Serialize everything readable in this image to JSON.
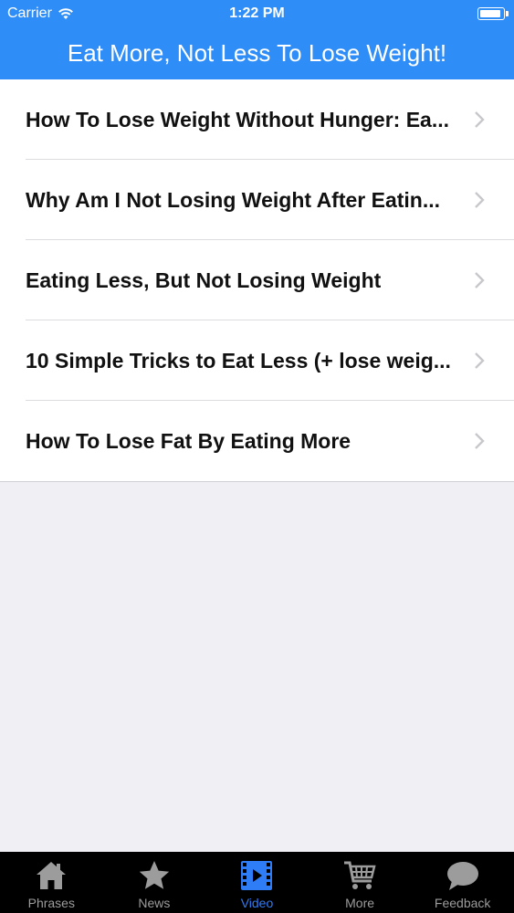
{
  "status_bar": {
    "carrier": "Carrier",
    "time": "1:22 PM",
    "battery_level": 0.95
  },
  "nav_bar": {
    "title": "Eat More, Not Less To Lose Weight!"
  },
  "list": {
    "items": [
      {
        "label": "How To Lose Weight Without Hunger: Ea..."
      },
      {
        "label": "Why Am I Not Losing Weight After Eatin..."
      },
      {
        "label": "Eating Less, But Not Losing Weight"
      },
      {
        "label": "10 Simple Tricks to Eat Less (+ lose weig..."
      },
      {
        "label": "How To Lose Fat By Eating More"
      }
    ]
  },
  "tab_bar": {
    "tabs": [
      {
        "label": "Phrases",
        "icon": "home-icon"
      },
      {
        "label": "News",
        "icon": "star-icon"
      },
      {
        "label": "Video",
        "icon": "film-icon",
        "active": true
      },
      {
        "label": "More",
        "icon": "cart-icon"
      },
      {
        "label": "Feedback",
        "icon": "chat-bubble-icon"
      }
    ],
    "active_color": "#2e7cf6",
    "inactive_color": "#9c9c9c"
  },
  "colors": {
    "accent": "#2e8df7",
    "background": "#efeff4"
  }
}
